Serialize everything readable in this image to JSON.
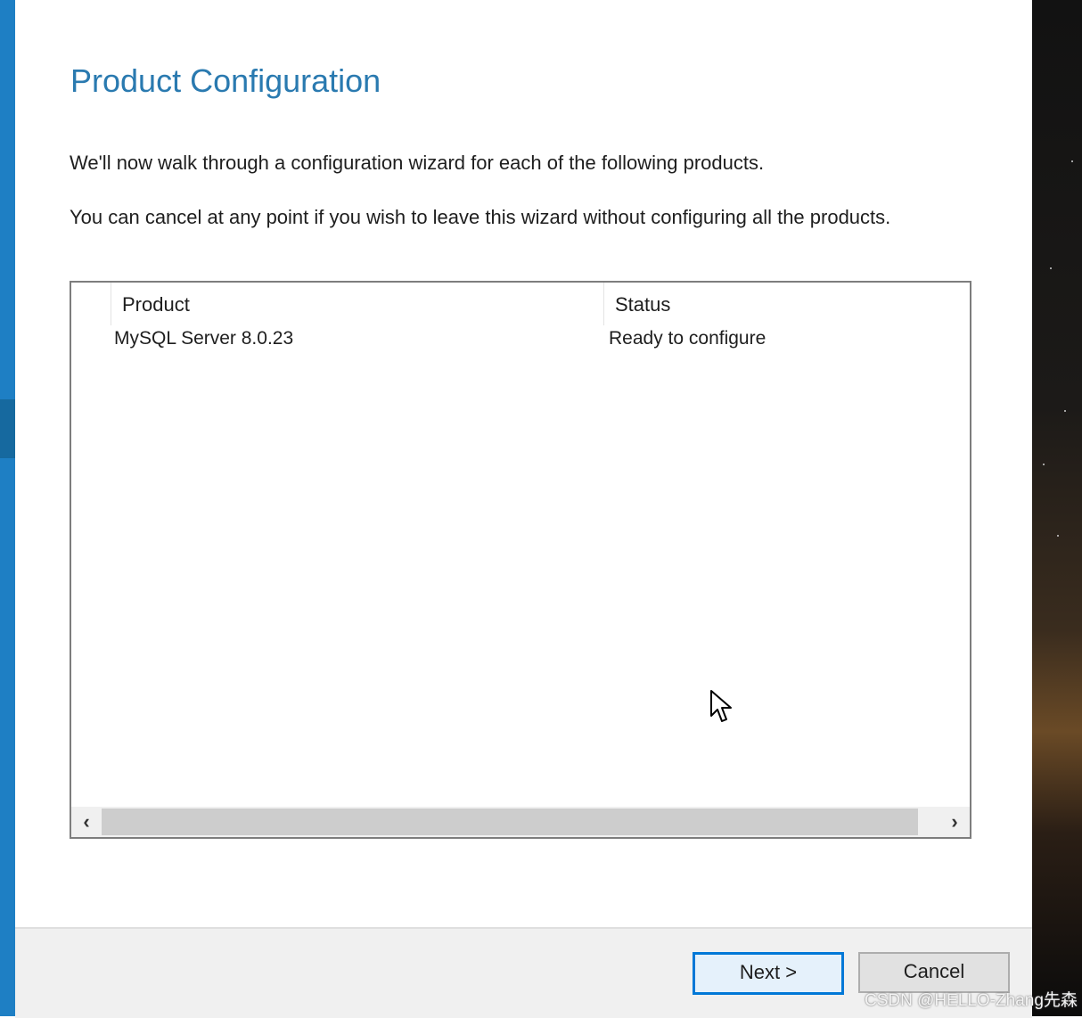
{
  "wizard": {
    "title": "Product Configuration",
    "intro": "We'll now walk through a configuration wizard for each of the following products.",
    "cancel_note": "You can cancel at any point if you wish to leave this wizard without configuring all the products."
  },
  "products_table": {
    "columns": [
      "Product",
      "Status"
    ],
    "rows": [
      {
        "product": "MySQL Server 8.0.23",
        "status": "Ready to configure"
      }
    ]
  },
  "buttons": {
    "next": "Next >",
    "cancel": "Cancel"
  },
  "watermark": "CSDN @HELLO-Zhang先森",
  "icons": {
    "scroll_left": "chevron-left-icon",
    "scroll_right": "chevron-right-icon",
    "pointer": "mouse-pointer-icon"
  },
  "colors": {
    "accent": "#1e7fc4",
    "title": "#2a7ab0",
    "default_button_border": "#0078d7"
  }
}
